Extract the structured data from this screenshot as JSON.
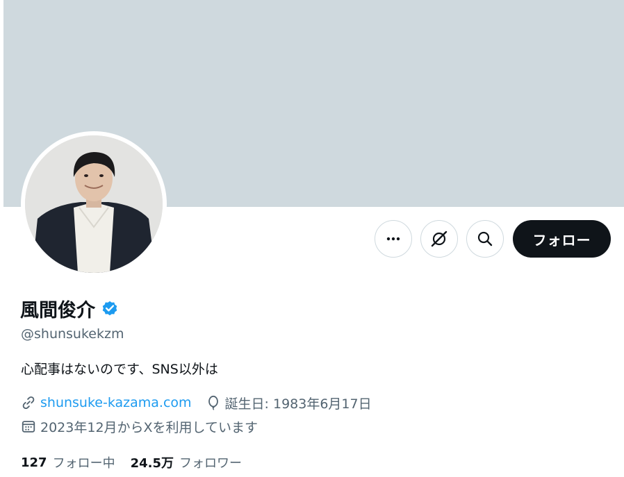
{
  "profile": {
    "display_name": "風間俊介",
    "handle": "@shunsuke­kzm",
    "bio": "心配事はないのです、SNS以外は",
    "website": "shunsuke-kazama.com",
    "birthday": "誕生日: 1983年6月17日",
    "joined": "2023年12月からXを利用しています",
    "verified": true
  },
  "actions": {
    "follow_label": "フォロー",
    "more_icon": "more-icon",
    "grok_icon": "grok-icon",
    "search_icon": "search-icon"
  },
  "stats": {
    "following_count": "127",
    "following_label": "フォロー中",
    "followers_count": "24.5万",
    "followers_label": "フォロワー"
  },
  "colors": {
    "banner": "#cfd9de",
    "accent": "#1d9bf0",
    "text_primary": "#0f1419",
    "text_secondary": "#536471",
    "follow_button": "#0f1419"
  }
}
